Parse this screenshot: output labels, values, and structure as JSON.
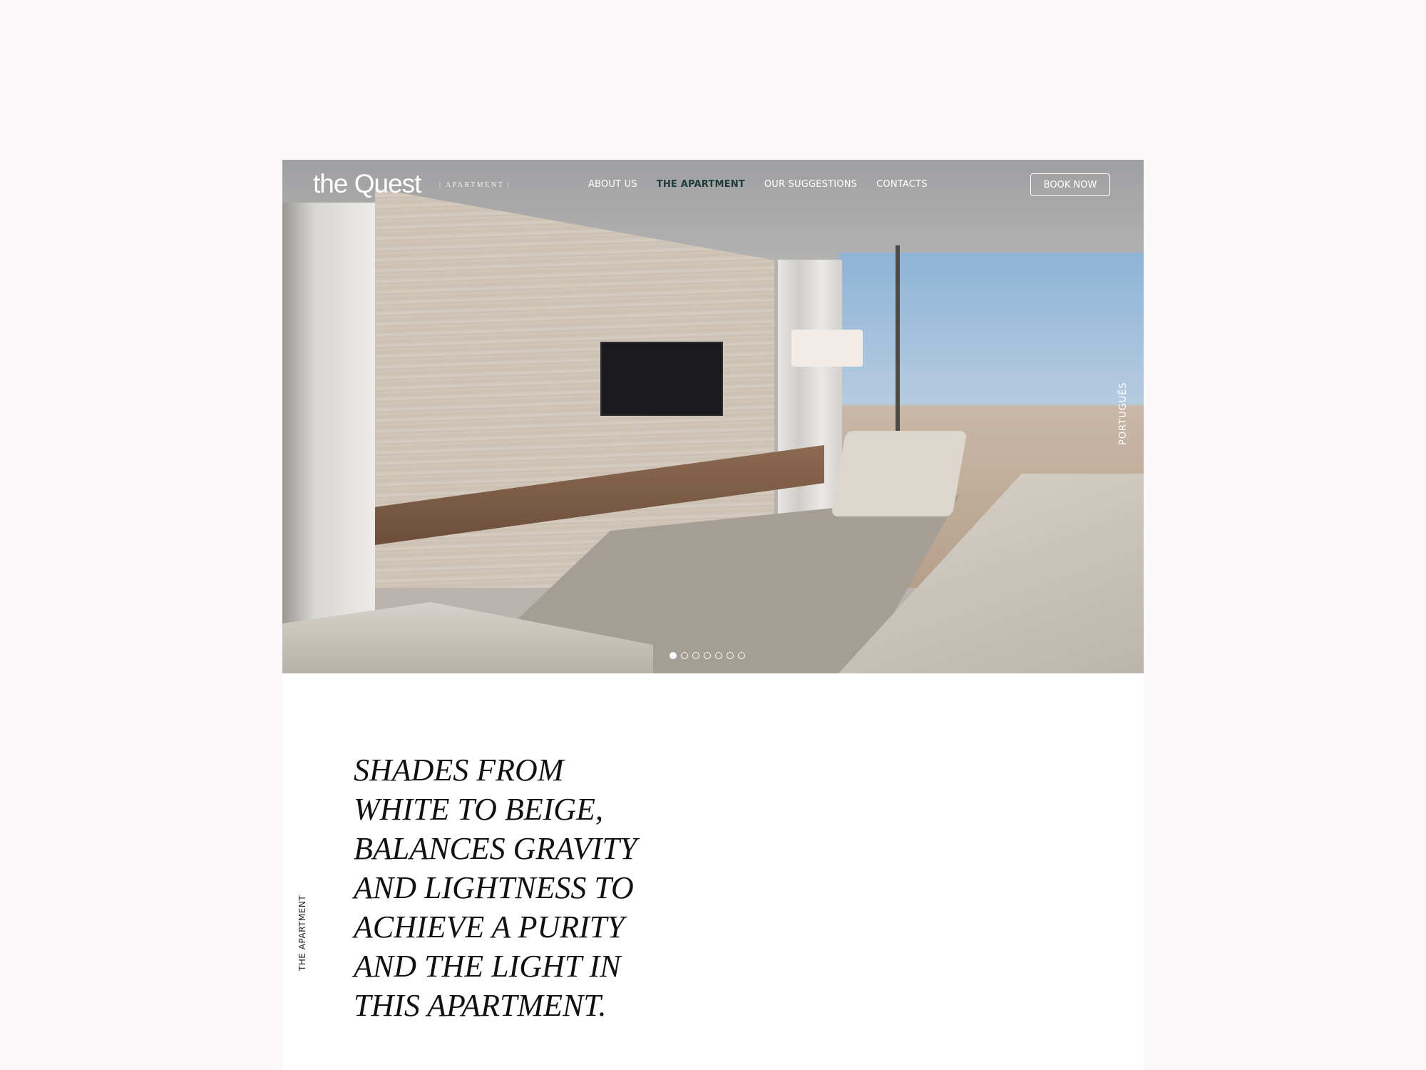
{
  "nav": {
    "logo": "the Quest",
    "logo_sub": "| APARTMENT |",
    "menu": [
      {
        "label": "ABOUT US",
        "active": false
      },
      {
        "label": "THE APARTMENT",
        "active": true
      },
      {
        "label": "OUR SUGGESTIONS",
        "active": false
      },
      {
        "label": "CONTACTS",
        "active": false
      }
    ],
    "book_label": "BOOK NOW"
  },
  "hero": {
    "language_label": "PORTUGUÊS",
    "slides_total": 7,
    "slide_active": 1
  },
  "section": {
    "side_label": "THE APARTMENT",
    "headline_lines": [
      "SHADES FROM",
      "WHITE TO BEIGE,",
      "BALANCES GRAVITY",
      "AND LIGHTNESS TO",
      "ACHIEVE A PURITY",
      "AND THE LIGHT IN",
      "THIS APARTMENT."
    ]
  },
  "colors": {
    "page_bg": "#faf8f9",
    "active_nav": "#1f3b33"
  }
}
